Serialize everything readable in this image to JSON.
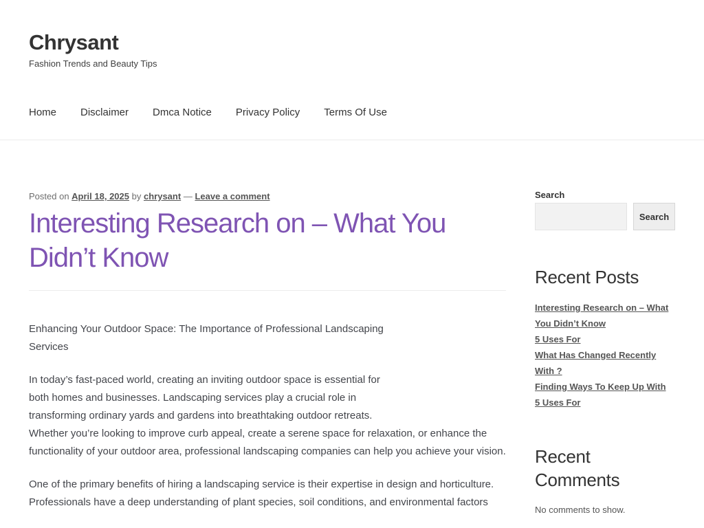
{
  "site": {
    "title": "Chrysant",
    "tagline": "Fashion Trends and Beauty Tips"
  },
  "nav": {
    "items": [
      "Home",
      "Disclaimer",
      "Dmca Notice",
      "Privacy Policy",
      "Terms Of Use"
    ]
  },
  "post": {
    "meta_prefix": "Posted on",
    "date": "April 18, 2025",
    "by": "by",
    "author": "chrysant",
    "dash": "—",
    "comment_link": "Leave a comment",
    "title": "Interesting Research on – What You Didn’t Know",
    "paragraphs": [
      "Enhancing Your Outdoor Space: The Importance of Professional Landscaping Services",
      "In today’s fast-paced world, creating an inviting outdoor space is essential for both homes and businesses. Landscaping services play a crucial role in transforming ordinary yards and gardens into breathtaking outdoor retreats.",
      "Whether you’re looking to improve curb appeal, create a serene space for relaxation, or enhance the functionality of your outdoor area, professional landscaping companies can help you achieve your vision.",
      "One of the primary benefits of hiring a landscaping service is their expertise in design and horticulture. Professionals have a deep understanding of plant species, soil conditions, and environmental factors"
    ]
  },
  "sidebar": {
    "search_label": "Search",
    "search_button": "Search",
    "recent_posts_title": "Recent Posts",
    "recent_posts": [
      "Interesting Research on – What You Didn’t Know",
      "5 Uses For",
      "What Has Changed Recently With ?",
      "Finding Ways To Keep Up With",
      "5 Uses For"
    ],
    "recent_comments_title": "Recent Comments",
    "no_comments": "No comments to show."
  },
  "colors": {
    "accent": "#7f54b3",
    "text": "#43454b"
  }
}
